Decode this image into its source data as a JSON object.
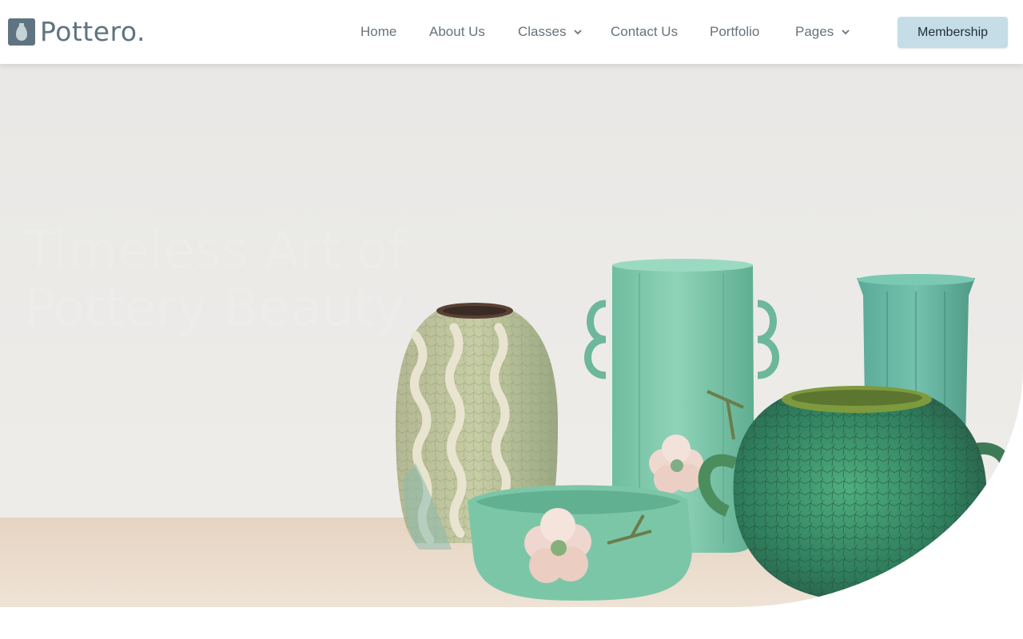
{
  "brand": {
    "name": "Pottero."
  },
  "nav": {
    "items": [
      {
        "label": "Home"
      },
      {
        "label": "About Us"
      },
      {
        "label": "Classes"
      },
      {
        "label": "Contact Us"
      },
      {
        "label": "Portfolio"
      },
      {
        "label": "Pages"
      }
    ]
  },
  "membership_button": {
    "label": "Membership"
  },
  "hero": {
    "heading": "Timeless Art of Pottery Beauty",
    "image_subject": "ceramic vases on a wooden shelf"
  },
  "colors": {
    "accent_button": "#c5dde6",
    "logo": "#5f7480",
    "nav_text": "#66737c",
    "celadon": "#7fc7ab"
  },
  "icons": {
    "dropdown": "chevron-down-icon",
    "logo": "vase-logo-icon"
  }
}
